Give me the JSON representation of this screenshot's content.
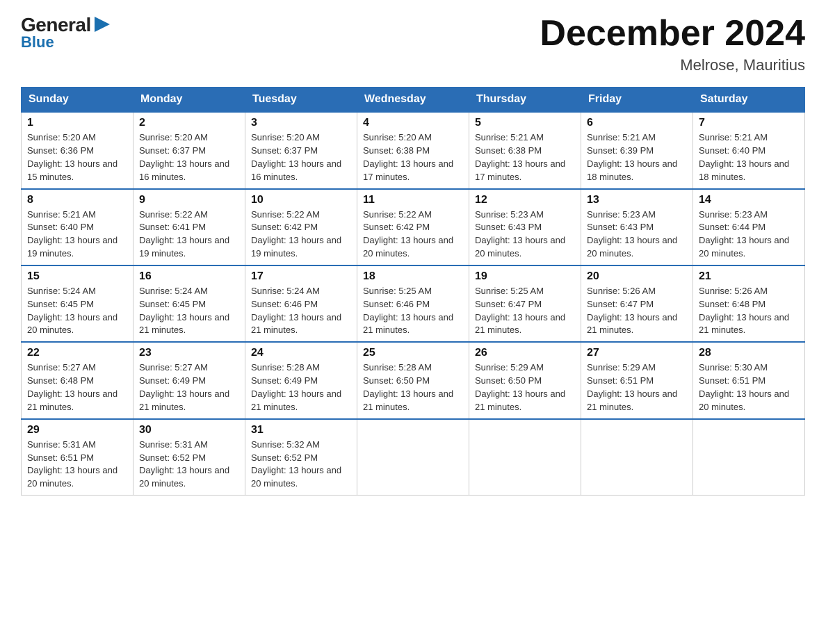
{
  "logo": {
    "general": "General",
    "blue": "Blue",
    "triangle": "▶"
  },
  "title": {
    "month_year": "December 2024",
    "location": "Melrose, Mauritius"
  },
  "weekdays": [
    "Sunday",
    "Monday",
    "Tuesday",
    "Wednesday",
    "Thursday",
    "Friday",
    "Saturday"
  ],
  "weeks": [
    [
      {
        "day": "1",
        "sunrise": "5:20 AM",
        "sunset": "6:36 PM",
        "daylight": "13 hours and 15 minutes."
      },
      {
        "day": "2",
        "sunrise": "5:20 AM",
        "sunset": "6:37 PM",
        "daylight": "13 hours and 16 minutes."
      },
      {
        "day": "3",
        "sunrise": "5:20 AM",
        "sunset": "6:37 PM",
        "daylight": "13 hours and 16 minutes."
      },
      {
        "day": "4",
        "sunrise": "5:20 AM",
        "sunset": "6:38 PM",
        "daylight": "13 hours and 17 minutes."
      },
      {
        "day": "5",
        "sunrise": "5:21 AM",
        "sunset": "6:38 PM",
        "daylight": "13 hours and 17 minutes."
      },
      {
        "day": "6",
        "sunrise": "5:21 AM",
        "sunset": "6:39 PM",
        "daylight": "13 hours and 18 minutes."
      },
      {
        "day": "7",
        "sunrise": "5:21 AM",
        "sunset": "6:40 PM",
        "daylight": "13 hours and 18 minutes."
      }
    ],
    [
      {
        "day": "8",
        "sunrise": "5:21 AM",
        "sunset": "6:40 PM",
        "daylight": "13 hours and 19 minutes."
      },
      {
        "day": "9",
        "sunrise": "5:22 AM",
        "sunset": "6:41 PM",
        "daylight": "13 hours and 19 minutes."
      },
      {
        "day": "10",
        "sunrise": "5:22 AM",
        "sunset": "6:42 PM",
        "daylight": "13 hours and 19 minutes."
      },
      {
        "day": "11",
        "sunrise": "5:22 AM",
        "sunset": "6:42 PM",
        "daylight": "13 hours and 20 minutes."
      },
      {
        "day": "12",
        "sunrise": "5:23 AM",
        "sunset": "6:43 PM",
        "daylight": "13 hours and 20 minutes."
      },
      {
        "day": "13",
        "sunrise": "5:23 AM",
        "sunset": "6:43 PM",
        "daylight": "13 hours and 20 minutes."
      },
      {
        "day": "14",
        "sunrise": "5:23 AM",
        "sunset": "6:44 PM",
        "daylight": "13 hours and 20 minutes."
      }
    ],
    [
      {
        "day": "15",
        "sunrise": "5:24 AM",
        "sunset": "6:45 PM",
        "daylight": "13 hours and 20 minutes."
      },
      {
        "day": "16",
        "sunrise": "5:24 AM",
        "sunset": "6:45 PM",
        "daylight": "13 hours and 21 minutes."
      },
      {
        "day": "17",
        "sunrise": "5:24 AM",
        "sunset": "6:46 PM",
        "daylight": "13 hours and 21 minutes."
      },
      {
        "day": "18",
        "sunrise": "5:25 AM",
        "sunset": "6:46 PM",
        "daylight": "13 hours and 21 minutes."
      },
      {
        "day": "19",
        "sunrise": "5:25 AM",
        "sunset": "6:47 PM",
        "daylight": "13 hours and 21 minutes."
      },
      {
        "day": "20",
        "sunrise": "5:26 AM",
        "sunset": "6:47 PM",
        "daylight": "13 hours and 21 minutes."
      },
      {
        "day": "21",
        "sunrise": "5:26 AM",
        "sunset": "6:48 PM",
        "daylight": "13 hours and 21 minutes."
      }
    ],
    [
      {
        "day": "22",
        "sunrise": "5:27 AM",
        "sunset": "6:48 PM",
        "daylight": "13 hours and 21 minutes."
      },
      {
        "day": "23",
        "sunrise": "5:27 AM",
        "sunset": "6:49 PM",
        "daylight": "13 hours and 21 minutes."
      },
      {
        "day": "24",
        "sunrise": "5:28 AM",
        "sunset": "6:49 PM",
        "daylight": "13 hours and 21 minutes."
      },
      {
        "day": "25",
        "sunrise": "5:28 AM",
        "sunset": "6:50 PM",
        "daylight": "13 hours and 21 minutes."
      },
      {
        "day": "26",
        "sunrise": "5:29 AM",
        "sunset": "6:50 PM",
        "daylight": "13 hours and 21 minutes."
      },
      {
        "day": "27",
        "sunrise": "5:29 AM",
        "sunset": "6:51 PM",
        "daylight": "13 hours and 21 minutes."
      },
      {
        "day": "28",
        "sunrise": "5:30 AM",
        "sunset": "6:51 PM",
        "daylight": "13 hours and 20 minutes."
      }
    ],
    [
      {
        "day": "29",
        "sunrise": "5:31 AM",
        "sunset": "6:51 PM",
        "daylight": "13 hours and 20 minutes."
      },
      {
        "day": "30",
        "sunrise": "5:31 AM",
        "sunset": "6:52 PM",
        "daylight": "13 hours and 20 minutes."
      },
      {
        "day": "31",
        "sunrise": "5:32 AM",
        "sunset": "6:52 PM",
        "daylight": "13 hours and 20 minutes."
      },
      null,
      null,
      null,
      null
    ]
  ],
  "labels": {
    "sunrise_prefix": "Sunrise: ",
    "sunset_prefix": "Sunset: ",
    "daylight_prefix": "Daylight: "
  }
}
